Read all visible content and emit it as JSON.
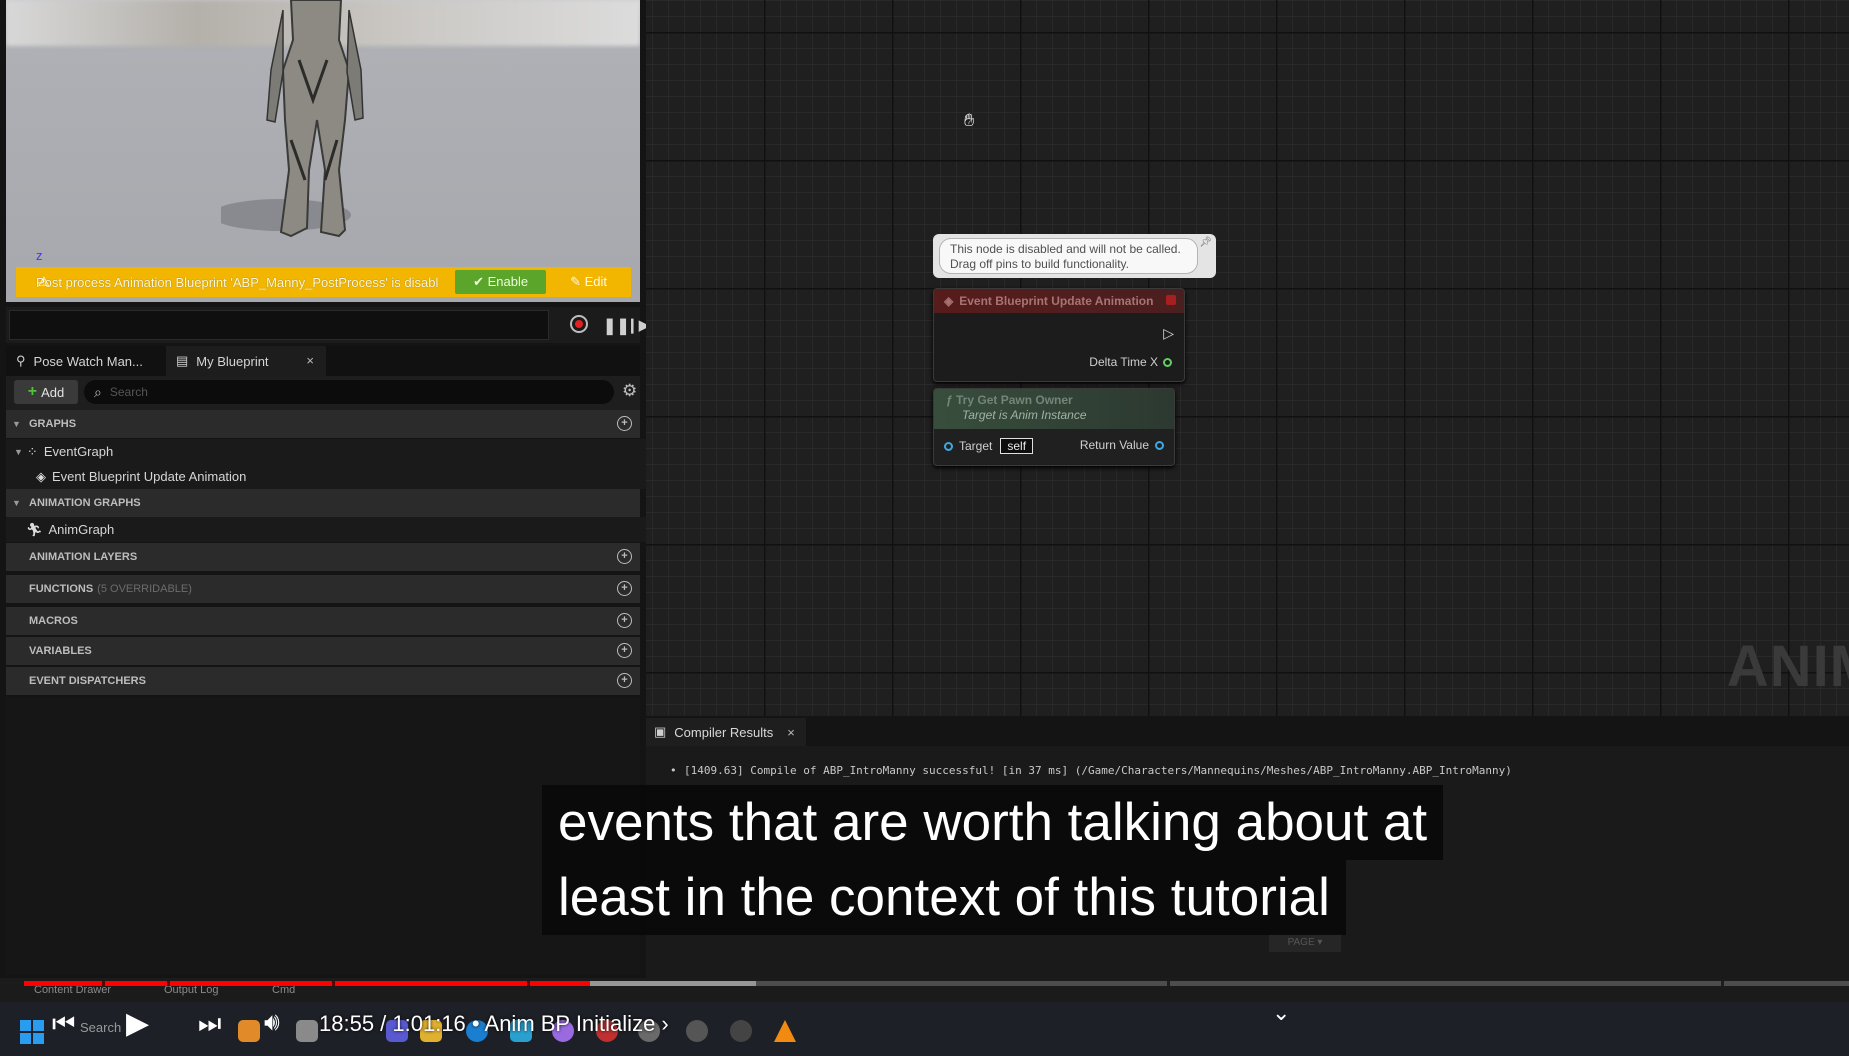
{
  "viewport": {
    "warning_text": "Post process Animation Blueprint 'ABP_Manny_PostProcess' is disabl",
    "enable_label": "✔ Enable",
    "edit_label": "✎ Edit",
    "axis_label": "z"
  },
  "tabs": [
    {
      "label": "Pose Watch Man...",
      "icon": "pose-watch-icon"
    },
    {
      "label": "My Blueprint",
      "icon": "blueprint-icon",
      "close": "×"
    }
  ],
  "toolbar": {
    "add_label": "Add",
    "search_placeholder": "Search"
  },
  "sections": {
    "graphs": "GRAPHS",
    "event_graph": "EventGraph",
    "event_update": "Event Blueprint Update Animation",
    "animation_graphs": "ANIMATION GRAPHS",
    "anim_graph": "AnimGraph",
    "animation_layers": "ANIMATION LAYERS",
    "functions": "FUNCTIONS",
    "functions_sub": "(5 OVERRIDABLE)",
    "macros": "MACROS",
    "variables": "VARIABLES",
    "event_dispatchers": "EVENT DISPATCHERS"
  },
  "graph": {
    "comment_line1": "This node is disabled and will not be called.",
    "comment_line2": "Drag off pins to build functionality.",
    "event_node_title": "Event Blueprint Update Animation",
    "event_node_pin": "Delta Time X",
    "pawn_node_title": "Try Get Pawn Owner",
    "pawn_node_subtitle": "Target is Anim Instance",
    "pawn_target": "Target",
    "pawn_self": "self",
    "pawn_return": "Return Value",
    "watermark": "ANIM"
  },
  "compiler": {
    "tab_label": "Compiler Results",
    "close": "×",
    "message": "[1409.63] Compile of ABP_IntroManny successful! [in 37 ms] (/Game/Characters/Mannequins/Meshes/ABP_IntroManny.ABP_IntroManny)",
    "page_chip": "PAGE ▾"
  },
  "statusbar": {
    "content_drawer": "Content Drawer",
    "output_log": "Output Log",
    "cmd": "Cmd"
  },
  "taskbar": {
    "search": "Search"
  },
  "player": {
    "subtitle_line1": "events that are worth talking about at",
    "subtitle_line2": "least in the context of this tutorial",
    "time": "18:55 / 1:01:16",
    "chapter": "• Anim BP Initialize ›",
    "progress_played_fraction": 0.3101,
    "progress_loaded_fraction": 0.4013
  },
  "colors": {
    "warning": "#f2b600",
    "enable": "#5aa52a",
    "progress_red": "#ff0000"
  }
}
